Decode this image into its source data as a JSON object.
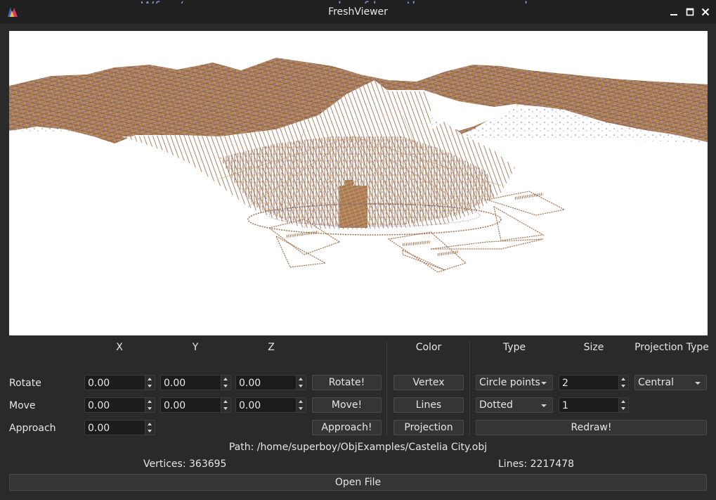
{
  "window": {
    "title": "FreshViewer"
  },
  "background_text": "Wf er/onn rou ...e an example of how the program works",
  "headers": {
    "x": "X",
    "y": "Y",
    "z": "Z",
    "color": "Color",
    "type": "Type",
    "size": "Size",
    "projection_type": "Projection Type"
  },
  "rows": {
    "rotate": {
      "label": "Rotate",
      "x": "0.00",
      "y": "0.00",
      "z": "0.00",
      "button": "Rotate!"
    },
    "move": {
      "label": "Move",
      "x": "0.00",
      "y": "0.00",
      "z": "0.00",
      "button": "Move!"
    },
    "approach": {
      "label": "Approach",
      "value": "0.00",
      "button": "Approach!"
    }
  },
  "color_buttons": {
    "vertex": "Vertex",
    "lines": "Lines",
    "projection": "Projection"
  },
  "vertex_settings": {
    "type": "Circle points",
    "size": "2"
  },
  "line_settings": {
    "type": "Dotted",
    "size": "1"
  },
  "projection": {
    "type": "Central"
  },
  "redraw_label": "Redraw!",
  "info": {
    "path": "Path: /home/superboy/ObjExamples/Castelia City.obj",
    "vertices": "Vertices: 363695",
    "lines": "Lines: 2217478"
  },
  "open_file_label": "Open File",
  "colors": {
    "vertex": "#6b6bd6",
    "lines": "#a0704a",
    "background": "#ffffff"
  },
  "icons": {
    "app": "freshviewer-logo-icon",
    "minimize": "minimize-icon",
    "maximize": "maximize-icon",
    "close": "close-icon"
  }
}
